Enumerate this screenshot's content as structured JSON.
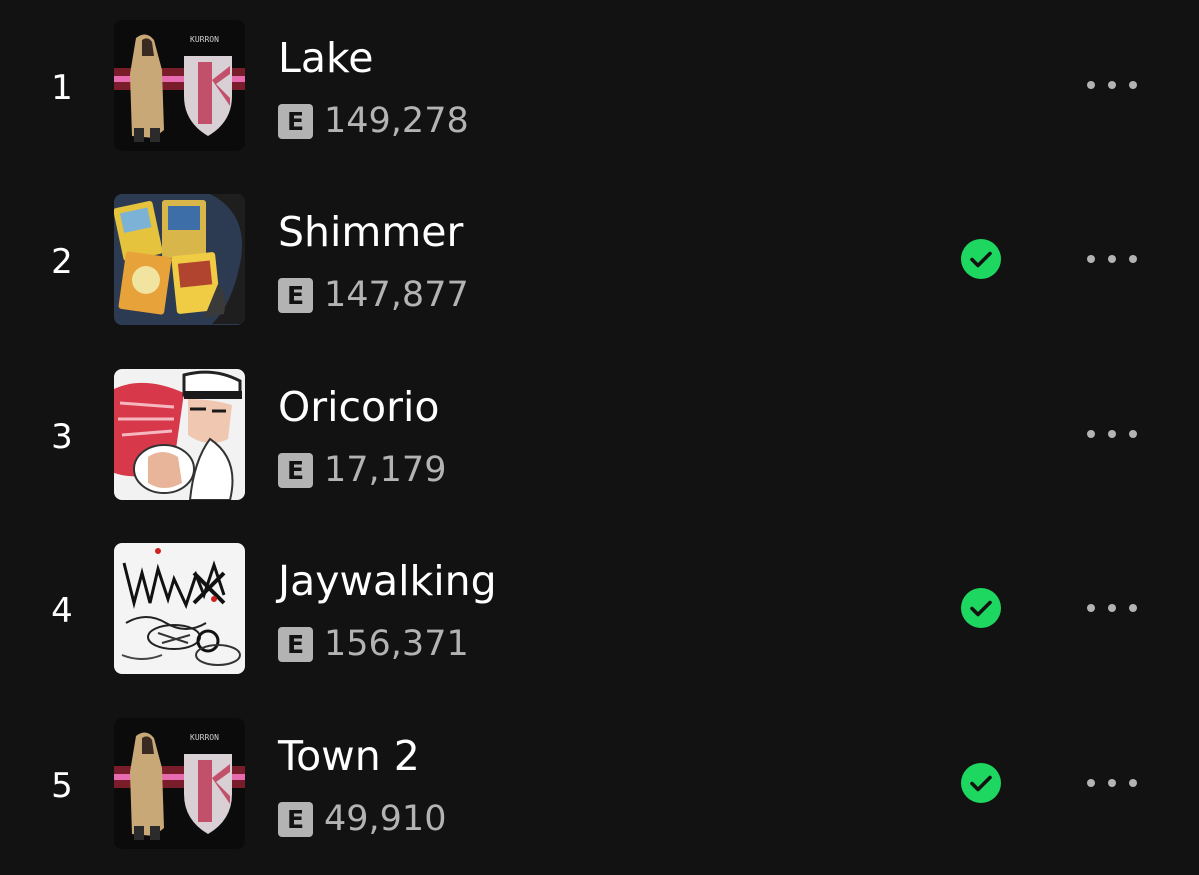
{
  "tracks": [
    {
      "rank": "1",
      "title": "Lake",
      "explicit": "E",
      "plays": "149,278",
      "saved": false,
      "cover_icon": "kurron-album-art-icon",
      "cover_text": "KURRON"
    },
    {
      "rank": "2",
      "title": "Shimmer",
      "explicit": "E",
      "plays": "147,877",
      "saved": true,
      "cover_icon": "trading-cards-album-art-icon"
    },
    {
      "rank": "3",
      "title": "Oricorio",
      "explicit": "E",
      "plays": "17,179",
      "saved": false,
      "cover_icon": "anime-character-album-art-icon"
    },
    {
      "rank": "4",
      "title": "Jaywalking",
      "explicit": "E",
      "plays": "156,371",
      "saved": true,
      "cover_icon": "sketch-doodle-album-art-icon"
    },
    {
      "rank": "5",
      "title": "Town 2",
      "explicit": "E",
      "plays": "49,910",
      "saved": true,
      "cover_icon": "kurron-album-art-icon",
      "cover_text": "KURRON"
    }
  ],
  "colors": {
    "background": "#121212",
    "saved_green": "#1ed760",
    "secondary_text": "#b3b3b3",
    "more_dots": "#b3b3b3"
  }
}
